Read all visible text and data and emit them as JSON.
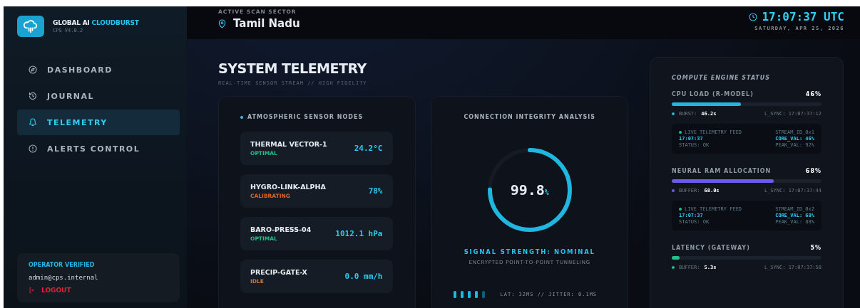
{
  "brand": {
    "name": "GLOBAL AI",
    "accent": "CLOUDBURST",
    "version": "CPS V4.0.2"
  },
  "nav": [
    {
      "label": "DASHBOARD",
      "selected": false
    },
    {
      "label": "JOURNAL",
      "selected": false
    },
    {
      "label": "TELEMETRY",
      "selected": true
    },
    {
      "label": "ALERTS CONTROL",
      "selected": false
    }
  ],
  "operator": {
    "status": "OPERATOR VERIFIED",
    "email": "admin@cps.internal",
    "logout": "LOGOUT"
  },
  "header": {
    "sector_label": "ACTIVE SCAN SECTOR",
    "sector": "Tamil Nadu",
    "time": "17:07:37 UTC",
    "date": "SATURDAY, APR 25, 2026"
  },
  "page": {
    "title": "SYSTEM TELEMETRY",
    "subtitle": "REAL-TIME SENSOR STREAM // HIGH FIDELITY"
  },
  "sensors": {
    "title": "ATMOSPHERIC SENSOR NODES",
    "nodes": [
      {
        "name": "THERMAL VECTOR-1",
        "status": "OPTIMAL",
        "color": "#22c08a",
        "value": "24.2°C"
      },
      {
        "name": "HYGRO-LINK-ALPHA",
        "status": "CALIBRATING",
        "color": "#e0652a",
        "value": "78%"
      },
      {
        "name": "BARO-PRESS-04",
        "status": "OPTIMAL",
        "color": "#22c08a",
        "value": "1012.1 hPa"
      },
      {
        "name": "PRECIP-GATE-X",
        "status": "IDLE",
        "color": "#d9731f",
        "value": "0.0 mm/h"
      }
    ]
  },
  "connection": {
    "title": "CONNECTION INTEGRITY ANALYSIS",
    "value": "99.8",
    "unit": "%",
    "level": 0.75,
    "signal": "SIGNAL STRENGTH: NOMINAL",
    "note": "ENCRYPTED POINT-TO-POINT TUNNELING",
    "stats": "LAT: 32MS // JITTER: 0.1MS"
  },
  "compute": {
    "title": "COMPUTE ENGINE STATUS",
    "metrics": [
      {
        "label": "CPU LOAD (R-MODEL)",
        "reading": "46%",
        "level": 0.46,
        "color": "#1fb6e0",
        "sub_label": "BURST:",
        "sub_value": "46.2s",
        "sync": "L_SYNC: 17:07:37:12",
        "log": {
          "title": "LIVE TELEMETRY FEED",
          "stream": "STREAM_ID_0x1",
          "time": "17:07:37",
          "core": "CORE_VAL: 46%",
          "state": "STATUS: OK",
          "peak": "PEAK_VAL: 92%"
        }
      },
      {
        "label": "NEURAL RAM ALLOCATION",
        "reading": "68%",
        "level": 0.68,
        "color": "#6a5cf0",
        "sub_label": "BUFFER:",
        "sub_value": "68.0s",
        "sync": "L_SYNC: 17:07:37:44",
        "log": {
          "title": "LIVE TELEMETRY FEED",
          "stream": "STREAM_ID_0x2",
          "time": "17:07:37",
          "core": "CORE_VAL: 68%",
          "state": "STATUS: OK",
          "peak": "PEAK_VAL: 88%"
        }
      },
      {
        "label": "LATENCY (GATEWAY)",
        "reading": "5%",
        "level": 0.05,
        "color": "#22c08a",
        "sub_label": "BUFFER:",
        "sub_value": "5.3s",
        "sync": "L_SYNC: 17:07:37:58"
      }
    ]
  }
}
